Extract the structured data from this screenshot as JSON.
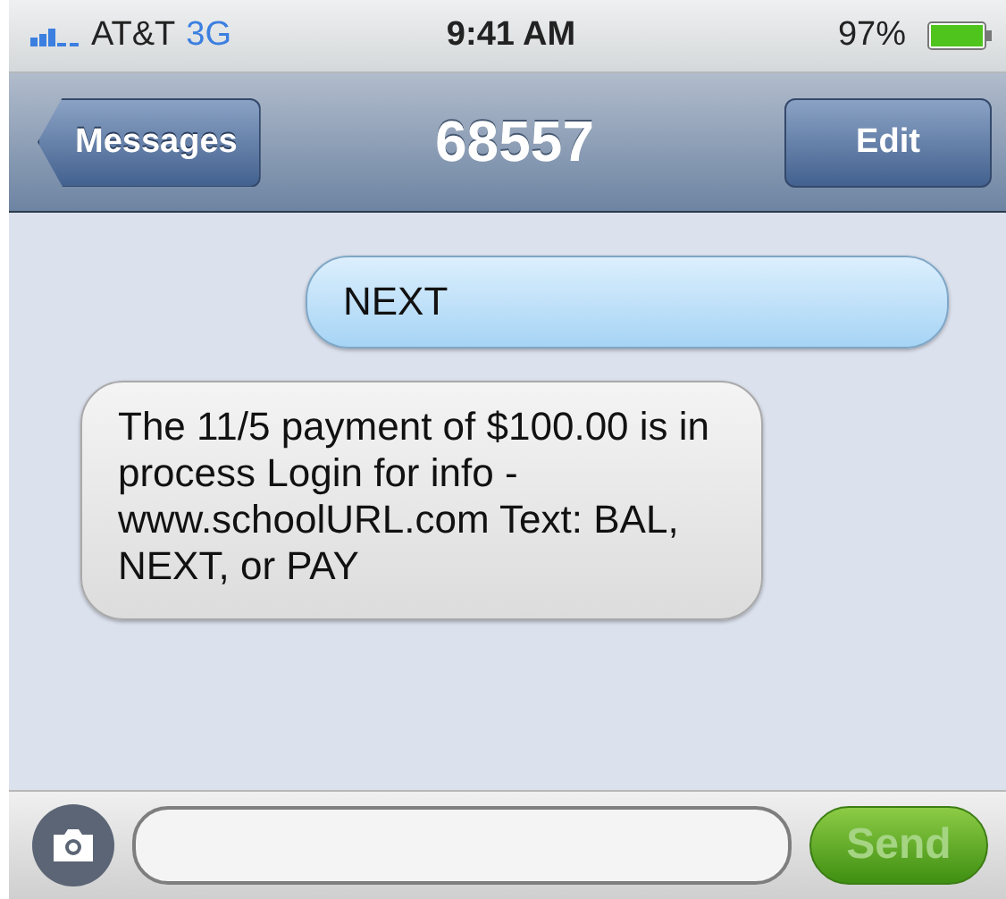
{
  "status_bar": {
    "carrier": "AT&T",
    "network": "3G",
    "time": "9:41 AM",
    "battery": "97%"
  },
  "nav_bar": {
    "back": "Messages",
    "title": "68557",
    "action": "Edit"
  },
  "messages": [
    {
      "kind": "sent",
      "text": "NEXT"
    },
    {
      "kind": "received",
      "text": "The 11/5 payment of $100.00 is in process Login for info - www.schoolURL.com Text: BAL, NEXT, or PAY"
    }
  ],
  "composer": {
    "send": "Send",
    "send_disabled": true
  }
}
